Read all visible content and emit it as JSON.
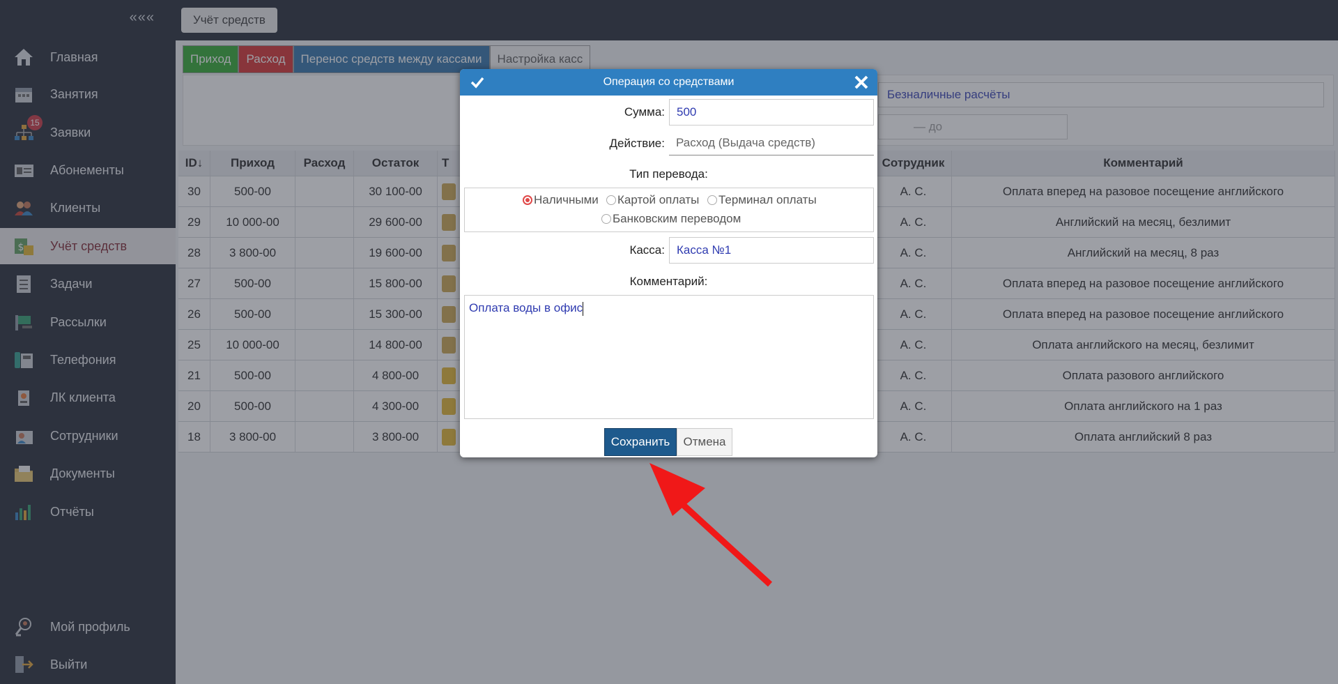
{
  "sidebar": {
    "collapse_label": "«««",
    "items": [
      {
        "label": "Главная",
        "icon": "home-icon"
      },
      {
        "label": "Занятия",
        "icon": "calendar-icon"
      },
      {
        "label": "Заявки",
        "icon": "org-chart-icon",
        "badge": "15"
      },
      {
        "label": "Абонементы",
        "icon": "id-card-icon"
      },
      {
        "label": "Клиенты",
        "icon": "users-icon"
      },
      {
        "label": "Учёт средств",
        "icon": "money-icon"
      },
      {
        "label": "Задачи",
        "icon": "checklist-icon"
      },
      {
        "label": "Рассылки",
        "icon": "mailing-icon"
      },
      {
        "label": "Телефония",
        "icon": "phone-icon"
      },
      {
        "label": "ЛК клиента",
        "icon": "badge-icon"
      },
      {
        "label": "Сотрудники",
        "icon": "staff-icon"
      },
      {
        "label": "Документы",
        "icon": "folder-icon"
      },
      {
        "label": "Отчёты",
        "icon": "bar-chart-icon"
      }
    ],
    "bottom": [
      {
        "label": "Мой профиль",
        "icon": "profile-icon"
      },
      {
        "label": "Выйти",
        "icon": "exit-icon"
      }
    ]
  },
  "topbar": {
    "page_tab": "Учёт средств"
  },
  "tabs": {
    "income": "Приход",
    "expense": "Расход",
    "transfer": "Перенос средств между кассами",
    "settings": "Настройка касс"
  },
  "filters": {
    "cashless": "Безналичные расчёты",
    "to_placeholder": "— до"
  },
  "table": {
    "headers": {
      "id": "ID↓",
      "income": "Приход",
      "expense": "Расход",
      "balance": "Остаток",
      "type": "Т",
      "staff": "Сотрудник",
      "comment": "Комментарий"
    },
    "rows": [
      {
        "id": "30",
        "income": "500-00",
        "expense": "",
        "balance": "30 100-00",
        "type": "cash",
        "staff": "А. С.",
        "comment": "Оплата вперед на разовое посещение английского"
      },
      {
        "id": "29",
        "income": "10 000-00",
        "expense": "",
        "balance": "29 600-00",
        "type": "cash",
        "staff": "А. С.",
        "comment": "Английский на месяц, безлимит"
      },
      {
        "id": "28",
        "income": "3 800-00",
        "expense": "",
        "balance": "19 600-00",
        "type": "cash",
        "staff": "А. С.",
        "comment": "Английский на месяц, 8 раз"
      },
      {
        "id": "27",
        "income": "500-00",
        "expense": "",
        "balance": "15 800-00",
        "type": "cash",
        "staff": "А. С.",
        "comment": "Оплата вперед на разовое посещение английского"
      },
      {
        "id": "26",
        "income": "500-00",
        "expense": "",
        "balance": "15 300-00",
        "type": "cash",
        "staff": "А. С.",
        "comment": "Оплата вперед на разовое посещение английского"
      },
      {
        "id": "25",
        "income": "10 000-00",
        "expense": "",
        "balance": "14 800-00",
        "type": "cash",
        "staff": "А. С.",
        "comment": "Оплата английского на месяц, безлимит"
      },
      {
        "id": "21",
        "income": "500-00",
        "expense": "",
        "balance": "4 800-00",
        "type": "card",
        "staff": "А. С.",
        "comment": "Оплата разового английского"
      },
      {
        "id": "20",
        "income": "500-00",
        "expense": "",
        "balance": "4 300-00",
        "type": "card",
        "staff": "А. С.",
        "comment": "Оплата английского на 1 раз"
      },
      {
        "id": "18",
        "income": "3 800-00",
        "expense": "",
        "balance": "3 800-00",
        "type": "card",
        "staff": "А. С.",
        "comment": "Оплата английский 8 раз"
      }
    ]
  },
  "modal": {
    "title": "Операция со средствами",
    "amount_label": "Сумма:",
    "amount_value": "500",
    "action_label": "Действие:",
    "action_value": "Расход (Выдача средств)",
    "transfer_type_label": "Тип перевода:",
    "radio": {
      "cash": "Наличными",
      "card": "Картой оплаты",
      "terminal": "Терминал оплаты",
      "bank": "Банковским переводом"
    },
    "kassa_label": "Касса:",
    "kassa_value": "Касса №1",
    "comment_label": "Комментарий:",
    "comment_value": "Оплата воды в офис",
    "save": "Сохранить",
    "cancel": "Отмена"
  },
  "colors": {
    "accent": "#2f7fc1",
    "save": "#1e5a8d",
    "income": "#2aa62a",
    "expense": "#d42b2b",
    "arrow": "#f01818"
  }
}
